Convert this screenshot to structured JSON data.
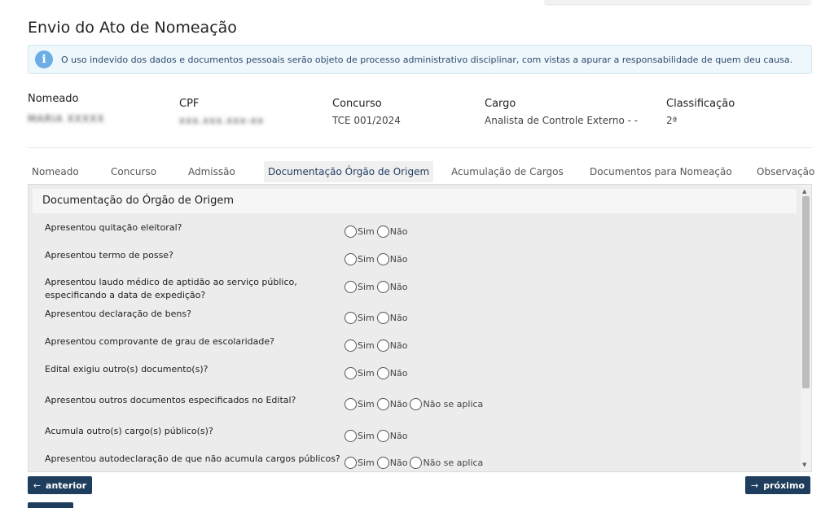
{
  "page": {
    "title": "Envio do Ato de Nomeação"
  },
  "alert": {
    "text": "O uso indevido dos dados e documentos pessoais serão objeto de processo administrativo disciplinar, com vistas a apurar a responsabilidade de quem deu causa."
  },
  "info": {
    "nomeado": {
      "label": "Nomeado",
      "value": "MARIA XXXXX"
    },
    "cpf": {
      "label": "CPF",
      "value": "xxx.xxx.xxx-xx"
    },
    "concurso": {
      "label": "Concurso",
      "value": "TCE 001/2024"
    },
    "cargo": {
      "label": "Cargo",
      "value": "Analista de Controle Externo - -"
    },
    "classificacao": {
      "label": "Classificação",
      "value": "2ª"
    }
  },
  "tabs": [
    {
      "label": "Nomeado"
    },
    {
      "label": "Concurso"
    },
    {
      "label": "Admissão"
    },
    {
      "label": "Documentação Órgão de Origem",
      "active": true
    },
    {
      "label": "Acumulação de Cargos"
    },
    {
      "label": "Documentos para Nomeação"
    },
    {
      "label": "Observação"
    }
  ],
  "panel": {
    "title": "Documentação do Órgão de Origem",
    "option_sim": "Sim",
    "option_nao": "Não",
    "option_nsa": "Não se aplica",
    "questions": [
      {
        "text": "Apresentou quitação eleitoral?"
      },
      {
        "text": "Apresentou termo de posse?"
      },
      {
        "text": "Apresentou laudo médico de aptidão ao serviço público, especificando a data de expedição?"
      },
      {
        "text": "Apresentou declaração de bens?"
      },
      {
        "text": "Apresentou comprovante de grau de escolaridade?"
      },
      {
        "text": "Edital exigiu outro(s) documento(s)?"
      },
      {
        "text": "Apresentou outros documentos especificados no Edital?"
      },
      {
        "text": "Acumula outro(s) cargo(s) público(s)?"
      },
      {
        "text": "Apresentou autodeclaração de que não acumula cargos públicos?"
      }
    ]
  },
  "buttons": {
    "prev_label": "anterior",
    "next_label": "próximo"
  },
  "icons": {
    "info": "info-circle-icon",
    "arrow_left": "arrow-left-icon",
    "arrow_right": "arrow-right-icon"
  },
  "colors": {
    "primary_button": "#1f3d5c",
    "alert_bg": "#eef7fb",
    "info_icon": "#6aaee5"
  }
}
